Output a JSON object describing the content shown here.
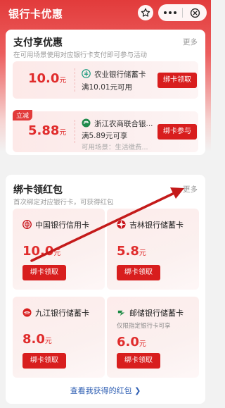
{
  "header": {
    "title": "银行卡优惠",
    "colors": {
      "brand_red": "#e23b3b",
      "button_red": "#d81e1e"
    }
  },
  "pay_section": {
    "title": "支付享优惠",
    "subtitle": "在可用场景使用对应银行卡支付即可参与活动",
    "more": "更多",
    "offers": [
      {
        "badge": "",
        "amount": "10.0",
        "unit": "元",
        "bank": "农业银行储蓄卡",
        "condition": "满10.01元可用",
        "scene": "",
        "button": "绑卡领取",
        "logo_icon": "abc-bank-icon"
      },
      {
        "badge": "立减",
        "amount": "5.88",
        "unit": "元",
        "bank": "浙江农商联合银...",
        "condition": "满5.89元可享",
        "scene": "可用场景：生活缴费...",
        "button": "绑卡参与",
        "logo_icon": "zj-rural-bank-icon"
      }
    ]
  },
  "bind_section": {
    "title": "绑卡领红包",
    "subtitle": "首次绑定对应银行卡，可获得红包",
    "more": "更多",
    "cards": [
      {
        "bank": "中国银行信用卡",
        "limit": "",
        "amount": "10.0",
        "unit": "元",
        "button": "绑卡领取",
        "logo_icon": "boc-icon"
      },
      {
        "bank": "吉林银行储蓄卡",
        "limit": "",
        "amount": "5.8",
        "unit": "元",
        "button": "绑卡领取",
        "logo_icon": "jilin-bank-icon"
      },
      {
        "bank": "九江银行储蓄卡",
        "limit": "",
        "amount": "8.0",
        "unit": "元",
        "button": "绑卡领取",
        "logo_icon": "jiujiang-bank-icon"
      },
      {
        "bank": "邮储银行储蓄卡",
        "limit": "仅限指定银行卡可享",
        "amount": "6.0",
        "unit": "元",
        "button": "绑卡领取",
        "logo_icon": "psbc-icon"
      }
    ],
    "view_more": "查看我获得的红包 ❯"
  }
}
